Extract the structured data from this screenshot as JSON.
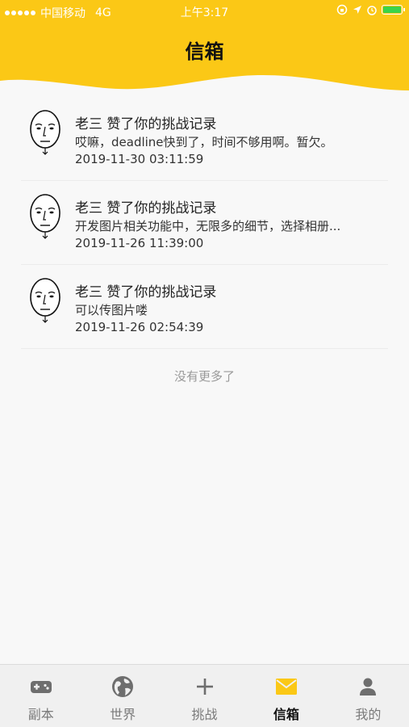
{
  "status_bar": {
    "carrier": "中国移动",
    "network": "4G",
    "time": "上午3:17"
  },
  "header": {
    "title": "信箱",
    "background_color": "#fbc816"
  },
  "messages": [
    {
      "title": "老三 赞了你的挑战记录",
      "content": "哎嘛，deadline快到了，时间不够用啊。暂欠。",
      "time": "2019-11-30 03:11:59",
      "avatar_icon": "face-sketch-icon"
    },
    {
      "title": "老三 赞了你的挑战记录",
      "content": "开发图片相关功能中，无限多的细节，选择相册...",
      "time": "2019-11-26 11:39:00",
      "avatar_icon": "face-sketch-icon"
    },
    {
      "title": "老三 赞了你的挑战记录",
      "content": "可以传图片喽",
      "time": "2019-11-26 02:54:39",
      "avatar_icon": "face-sketch-icon"
    }
  ],
  "list_footer": "没有更多了",
  "tabs": [
    {
      "label": "副本",
      "icon": "gamepad-icon",
      "active": false
    },
    {
      "label": "世界",
      "icon": "globe-icon",
      "active": false
    },
    {
      "label": "挑战",
      "icon": "plus-icon",
      "active": false
    },
    {
      "label": "信箱",
      "icon": "mail-icon",
      "active": true
    },
    {
      "label": "我的",
      "icon": "person-icon",
      "active": false
    }
  ],
  "colors": {
    "accent": "#fbc816",
    "tab_inactive": "#7a7a7a",
    "battery": "#3bd34a"
  }
}
